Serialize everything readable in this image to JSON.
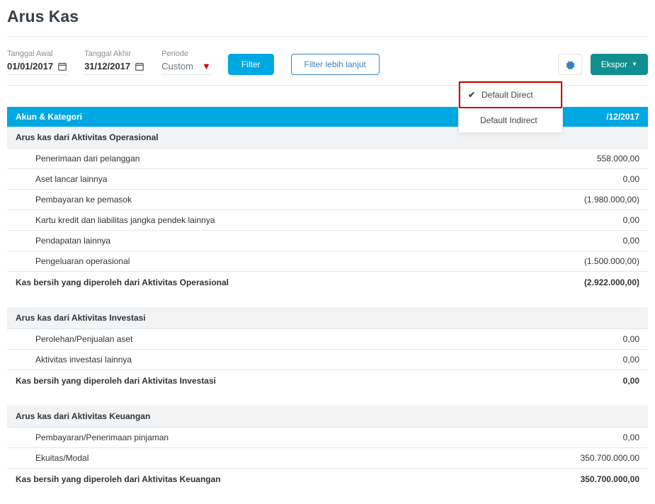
{
  "page_title": "Arus Kas",
  "filters": {
    "start_label": "Tanggal Awal",
    "start_value": "01/01/2017",
    "end_label": "Tanggal Akhir",
    "end_value": "31/12/2017",
    "period_label": "Periode",
    "period_value": "Custom",
    "filter_btn": "Filter",
    "adv_filter_btn": "Filter lebih lanjut",
    "export_btn": "Ekspor"
  },
  "settings_menu": {
    "opt_direct": "Default Direct",
    "opt_indirect": "Default Indirect"
  },
  "table_header": {
    "left": "Akun & Kategori",
    "right": "/12/2017"
  },
  "sections": [
    {
      "title": "Arus kas dari Aktivitas Operasional",
      "rows": [
        {
          "label": "Penerimaan dari pelanggan",
          "value": "558.000,00"
        },
        {
          "label": "Aset lancar lainnya",
          "value": "0,00"
        },
        {
          "label": "Pembayaran ke pemasok",
          "value": "(1.980.000,00)"
        },
        {
          "label": "Kartu kredit dan liabilitas jangka pendek lainnya",
          "value": "0,00"
        },
        {
          "label": "Pendapatan lainnya",
          "value": "0,00"
        },
        {
          "label": "Pengeluaran operasional",
          "value": "(1.500.000,00)"
        }
      ],
      "total_label": "Kas bersih yang diperoleh dari Aktivitas Operasional",
      "total_value": "(2.922.000,00)"
    },
    {
      "title": "Arus kas dari Aktivitas Investasi",
      "rows": [
        {
          "label": "Perolehan/Penjualan aset",
          "value": "0,00"
        },
        {
          "label": "Aktivitas investasi lainnya",
          "value": "0,00"
        }
      ],
      "total_label": "Kas bersih yang diperoleh dari Aktivitas Investasi",
      "total_value": "0,00"
    },
    {
      "title": "Arus kas dari Aktivitas Keuangan",
      "rows": [
        {
          "label": "Pembayaran/Penerimaan pinjaman",
          "value": "0,00"
        },
        {
          "label": "Ekuitas/Modal",
          "value": "350.700.000,00"
        }
      ],
      "total_label": "Kas bersih yang diperoleh dari Aktivitas Keuangan",
      "total_value": "350.700.000,00"
    }
  ]
}
